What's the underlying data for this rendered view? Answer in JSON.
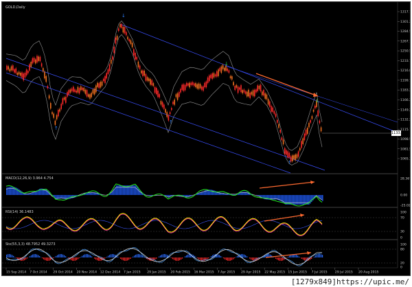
{
  "chart": {
    "title": "GOLD,Daily",
    "price_ticks": [
      "1317.70",
      "1301.25",
      "1284.50",
      "1267.70",
      "1250.55",
      "1233.70",
      "1216.80",
      "1199.70",
      "1183.20",
      "1166.20",
      "1149.25",
      "1132.20",
      "1115.70",
      "1098.50",
      "1081.50",
      "1065.35"
    ],
    "current_price": "1133.95",
    "date_ticks": [
      "15 Sep 2014",
      "7 Oct 2014",
      "29 Oct 2014",
      "20 Nov 2014",
      "12 Dec 2014",
      "7 Jan 2015",
      "29 Jan 2015",
      "20 Feb 2015",
      "16 Mar 2015",
      "7 Apr 2015",
      "29 Apr 2015",
      "22 May 2015",
      "15 Jun 2015",
      "7 Jul 2015",
      "29 Jul 2015",
      "20 Aug 2015"
    ],
    "colors": {
      "bull": "#f07020",
      "bear": "#ff2a2a",
      "channel": "#3a50ff",
      "envelope": "#9a9a9a",
      "arrow": "#ff6a30",
      "fractal": "#2f7fff",
      "fractal_up": "#22cc44"
    }
  },
  "indicators": {
    "macd": {
      "label": "MACD(12,26,9) 3.964 4.754",
      "ticks": [
        "28.367",
        "0.00",
        "-25.025"
      ]
    },
    "rsi": {
      "label": "RSI(14) 36.1483",
      "ticks": [
        "100",
        "70",
        "30",
        "0"
      ]
    },
    "stoch": {
      "label": "Sto(55,3,3) 48.7952 49.3273",
      "ticks": [
        "100",
        "80",
        "20",
        "0"
      ]
    }
  },
  "footer": {
    "text": "[1279x849]https://upic.me/"
  }
}
